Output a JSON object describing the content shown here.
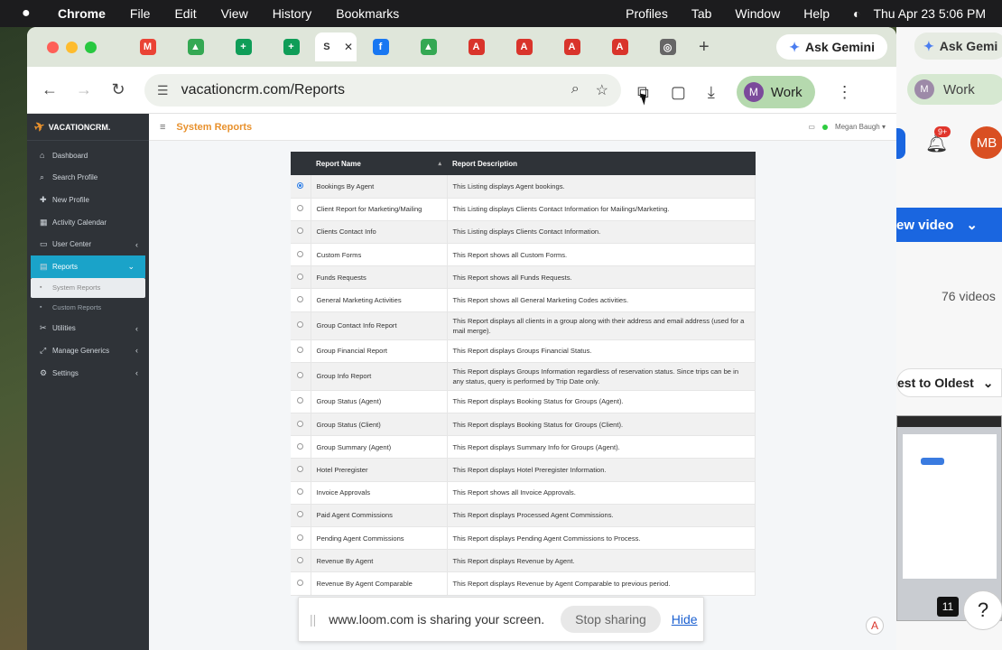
{
  "menubar": {
    "app": "Chrome",
    "items": [
      "File",
      "Edit",
      "View",
      "History",
      "Bookmarks"
    ],
    "right_items": [
      "Profiles",
      "Tab",
      "Window",
      "Help"
    ],
    "clock": "Thu Apr 23  5:06 PM"
  },
  "tabs": [
    {
      "icon": "gmail-icon",
      "color": "#ea4335",
      "glyph": "M"
    },
    {
      "icon": "drive-icon",
      "color": "#34a853",
      "glyph": "▲"
    },
    {
      "icon": "sheets-icon",
      "color": "#0f9d58",
      "glyph": "+"
    },
    {
      "icon": "sheets-icon",
      "color": "#0f9d58",
      "glyph": "+"
    },
    {
      "icon": "current-tab-icon",
      "color": "#777777",
      "glyph": "S",
      "active": true
    },
    {
      "icon": "facebook-icon",
      "color": "#1877f2",
      "glyph": "f"
    },
    {
      "icon": "drive-icon",
      "color": "#34a853",
      "glyph": "▲"
    },
    {
      "icon": "pdf-icon",
      "color": "#d9342b",
      "glyph": "A"
    },
    {
      "icon": "pdf-icon",
      "color": "#d9342b",
      "glyph": "A"
    },
    {
      "icon": "pdf-icon",
      "color": "#d9342b",
      "glyph": "A"
    },
    {
      "icon": "pdf-icon",
      "color": "#d9342b",
      "glyph": "A"
    },
    {
      "icon": "chrome-icon",
      "color": "#666666",
      "glyph": "◎"
    }
  ],
  "ask_gemini": "Ask Gemini",
  "toolbar": {
    "url": "vacationcrm.com/Reports",
    "profile_initial": "M",
    "profile_label": "Work"
  },
  "app": {
    "logo_text": "VACATIONCRM.",
    "page_title": "System Reports",
    "user_name": "Megan Baugh ▾",
    "nav": [
      {
        "label": "Dashboard",
        "icon": "home-icon",
        "glyph": "⌂"
      },
      {
        "label": "Search Profile",
        "icon": "search-icon",
        "glyph": "⌕"
      },
      {
        "label": "New Profile",
        "icon": "user-plus-icon",
        "glyph": "✚"
      },
      {
        "label": "Activity Calendar",
        "icon": "calendar-icon",
        "glyph": "▦"
      },
      {
        "label": "User Center",
        "icon": "monitor-icon",
        "glyph": "▭",
        "arrow": "‹"
      },
      {
        "label": "Reports",
        "icon": "reports-icon",
        "glyph": "▤",
        "arrow": "⌄",
        "active": true
      }
    ],
    "subnav": [
      {
        "label": "System Reports",
        "active": true
      },
      {
        "label": "Custom Reports"
      }
    ],
    "nav_bottom": [
      {
        "label": "Utilities",
        "icon": "tools-icon",
        "glyph": "✂",
        "arrow": "‹"
      },
      {
        "label": "Manage Generics",
        "icon": "manage-icon",
        "glyph": "⤢",
        "arrow": "‹"
      },
      {
        "label": "Settings",
        "icon": "settings-icon",
        "glyph": "⚙",
        "arrow": "‹"
      }
    ],
    "table": {
      "headers": [
        "Report Name",
        "Report Description"
      ],
      "rows": [
        {
          "name": "Bookings By Agent",
          "desc": "This Listing displays Agent bookings.",
          "selected": true
        },
        {
          "name": "Client Report for Marketing/Mailing",
          "desc": "This Listing displays Clients Contact Information for Mailings/Marketing."
        },
        {
          "name": "Clients Contact Info",
          "desc": "This Listing displays Clients Contact Information."
        },
        {
          "name": "Custom Forms",
          "desc": "This Report shows all Custom Forms."
        },
        {
          "name": "Funds Requests",
          "desc": "This Report shows all Funds Requests."
        },
        {
          "name": "General Marketing Activities",
          "desc": "This Report shows all General Marketing Codes activities."
        },
        {
          "name": "Group Contact Info Report",
          "desc": "This Report displays all clients in a group along with their address and email address (used for a mail merge).",
          "tall": true
        },
        {
          "name": "Group Financial Report",
          "desc": "This Report displays Groups Financial Status."
        },
        {
          "name": "Group Info Report",
          "desc": "This Report displays Groups Information regardless of reservation status. Since trips can be in any status, query is performed by Trip Date only.",
          "tall": true
        },
        {
          "name": "Group Status (Agent)",
          "desc": "This Report displays Booking Status for Groups (Agent)."
        },
        {
          "name": "Group Status (Client)",
          "desc": "This Report displays Booking Status for Groups (Client)."
        },
        {
          "name": "Group Summary (Agent)",
          "desc": "This Report displays Summary Info for Groups (Agent)."
        },
        {
          "name": "Hotel Preregister",
          "desc": "This Report displays Hotel Preregister Information."
        },
        {
          "name": "Invoice Approvals",
          "desc": "This Report shows all Invoice Approvals."
        },
        {
          "name": "Paid Agent Commissions",
          "desc": "This Report displays Processed Agent Commissions."
        },
        {
          "name": "Pending Agent Commissions",
          "desc": "This Report displays Pending Agent Commissions to Process."
        },
        {
          "name": "Revenue By Agent",
          "desc": "This Report displays Revenue by Agent."
        },
        {
          "name": "Revenue By Agent Comparable",
          "desc": "This Report displays Revenue by Agent Comparable to previous period."
        }
      ]
    }
  },
  "loom": {
    "message": "www.loom.com is sharing your screen.",
    "stop_label": "Stop sharing",
    "hide_label": "Hide"
  },
  "right_window": {
    "gemini": "Ask Gemi",
    "profile_initial": "M",
    "profile_label": "Work",
    "bell_badge": "9+",
    "avatar": "MB",
    "new_video": "ew video",
    "video_count": "76 videos",
    "sort": "est to Oldest",
    "rec": "11",
    "help": "?"
  }
}
